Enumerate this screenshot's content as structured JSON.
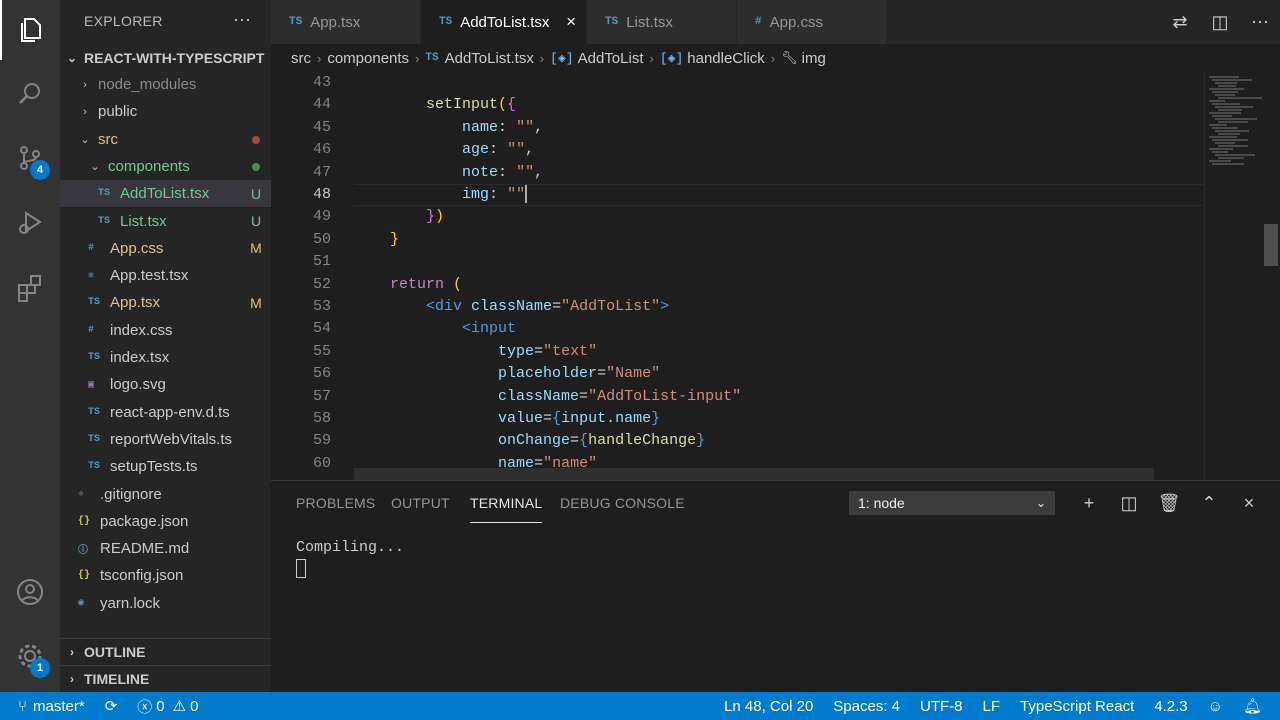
{
  "colors": {
    "accent": "#007acc",
    "modified": "#e2c08d",
    "untracked": "#73c991",
    "ts": "#519aba",
    "css": "#519aba"
  },
  "activity": {
    "scm_badge": "4",
    "settings_badge": "1"
  },
  "sidebar": {
    "title": "EXPLORER",
    "more": "···",
    "project": "REACT-WITH-TYPESCRIPT",
    "tree": [
      {
        "label": "node_modules",
        "kind": "folder",
        "open": false,
        "indent": 1,
        "color": "#8b8b8b",
        "mark": ""
      },
      {
        "label": "public",
        "kind": "folder",
        "open": false,
        "indent": 1,
        "color": "#cccccc",
        "mark": ""
      },
      {
        "label": "src",
        "kind": "folder",
        "open": true,
        "indent": 1,
        "color": "#e2c08d",
        "mark": "dot-red"
      },
      {
        "label": "components",
        "kind": "folder",
        "open": true,
        "indent": 2,
        "color": "#73c991",
        "mark": "dot-green"
      },
      {
        "label": "AddToList.tsx",
        "kind": "ts",
        "indent": 3,
        "color": "#73c991",
        "mark": "U",
        "selected": true
      },
      {
        "label": "List.tsx",
        "kind": "ts",
        "indent": 3,
        "color": "#73c991",
        "mark": "U"
      },
      {
        "label": "App.css",
        "kind": "css",
        "indent": 2,
        "color": "#e2c08d",
        "mark": "M"
      },
      {
        "label": "App.test.tsx",
        "kind": "react",
        "indent": 2,
        "color": "#cccccc",
        "mark": ""
      },
      {
        "label": "App.tsx",
        "kind": "ts",
        "indent": 2,
        "color": "#e2c08d",
        "mark": "M"
      },
      {
        "label": "index.css",
        "kind": "css",
        "indent": 2,
        "color": "#cccccc",
        "mark": ""
      },
      {
        "label": "index.tsx",
        "kind": "ts",
        "indent": 2,
        "color": "#cccccc",
        "mark": ""
      },
      {
        "label": "logo.svg",
        "kind": "svg",
        "indent": 2,
        "color": "#cccccc",
        "mark": ""
      },
      {
        "label": "react-app-env.d.ts",
        "kind": "ts",
        "indent": 2,
        "color": "#cccccc",
        "mark": ""
      },
      {
        "label": "reportWebVitals.ts",
        "kind": "ts",
        "indent": 2,
        "color": "#cccccc",
        "mark": ""
      },
      {
        "label": "setupTests.ts",
        "kind": "ts",
        "indent": 2,
        "color": "#cccccc",
        "mark": ""
      },
      {
        "label": ".gitignore",
        "kind": "git",
        "indent": 1,
        "color": "#cccccc",
        "mark": ""
      },
      {
        "label": "package.json",
        "kind": "json",
        "indent": 1,
        "color": "#cccccc",
        "mark": ""
      },
      {
        "label": "README.md",
        "kind": "info",
        "indent": 1,
        "color": "#cccccc",
        "mark": ""
      },
      {
        "label": "tsconfig.json",
        "kind": "json",
        "indent": 1,
        "color": "#cccccc",
        "mark": ""
      },
      {
        "label": "yarn.lock",
        "kind": "yarn",
        "indent": 1,
        "color": "#cccccc",
        "mark": ""
      }
    ],
    "outline": "OUTLINE",
    "timeline": "TIMELINE"
  },
  "tabs": [
    {
      "icon": "TS",
      "label": "App.tsx",
      "active": false
    },
    {
      "icon": "TS",
      "label": "AddToList.tsx",
      "active": true
    },
    {
      "icon": "TS",
      "label": "List.tsx",
      "active": false
    },
    {
      "icon": "#",
      "label": "App.css",
      "active": false
    }
  ],
  "breadcrumb": {
    "src": "src",
    "components": "components",
    "file_icon": "TS",
    "file": "AddToList.tsx",
    "component": "AddToList",
    "method": "handleClick",
    "prop": "img"
  },
  "editor": {
    "current_line": 48,
    "lines": [
      {
        "n": "43",
        "tokens": []
      },
      {
        "n": "44",
        "tokens": [
          [
            "plain",
            "        "
          ],
          [
            "fn",
            "setInput"
          ],
          [
            "br",
            "("
          ],
          [
            "br2",
            "{"
          ]
        ]
      },
      {
        "n": "45",
        "tokens": [
          [
            "plain",
            "            "
          ],
          [
            "prop",
            "name"
          ],
          [
            "plain",
            ": "
          ],
          [
            "str",
            "\"\""
          ],
          [
            "plain",
            ","
          ]
        ]
      },
      {
        "n": "46",
        "tokens": [
          [
            "plain",
            "            "
          ],
          [
            "prop",
            "age"
          ],
          [
            "plain",
            ": "
          ],
          [
            "str",
            "\"\""
          ],
          [
            "plain",
            ","
          ]
        ]
      },
      {
        "n": "47",
        "tokens": [
          [
            "plain",
            "            "
          ],
          [
            "prop",
            "note"
          ],
          [
            "plain",
            ": "
          ],
          [
            "str",
            "\"\""
          ],
          [
            "plain",
            ","
          ]
        ]
      },
      {
        "n": "48",
        "tokens": [
          [
            "plain",
            "            "
          ],
          [
            "prop",
            "img"
          ],
          [
            "plain",
            ": "
          ],
          [
            "str",
            "\"\""
          ]
        ],
        "caret": true
      },
      {
        "n": "49",
        "tokens": [
          [
            "plain",
            "        "
          ],
          [
            "br2",
            "}"
          ],
          [
            "br",
            ")"
          ]
        ]
      },
      {
        "n": "50",
        "tokens": [
          [
            "plain",
            "    "
          ],
          [
            "br",
            "}"
          ]
        ]
      },
      {
        "n": "51",
        "tokens": []
      },
      {
        "n": "52",
        "tokens": [
          [
            "plain",
            "    "
          ],
          [
            "kw",
            "return"
          ],
          [
            "plain",
            " "
          ],
          [
            "br",
            "("
          ]
        ]
      },
      {
        "n": "53",
        "tokens": [
          [
            "plain",
            "        "
          ],
          [
            "tag",
            "<div"
          ],
          [
            "plain",
            " "
          ],
          [
            "prop",
            "className"
          ],
          [
            "plain",
            "="
          ],
          [
            "str",
            "\"AddToList\""
          ],
          [
            "tag",
            ">"
          ]
        ]
      },
      {
        "n": "54",
        "tokens": [
          [
            "plain",
            "            "
          ],
          [
            "tag",
            "<input"
          ]
        ]
      },
      {
        "n": "55",
        "tokens": [
          [
            "plain",
            "                "
          ],
          [
            "prop",
            "type"
          ],
          [
            "plain",
            "="
          ],
          [
            "str",
            "\"text\""
          ]
        ]
      },
      {
        "n": "56",
        "tokens": [
          [
            "plain",
            "                "
          ],
          [
            "prop",
            "placeholder"
          ],
          [
            "plain",
            "="
          ],
          [
            "str",
            "\"Name\""
          ]
        ]
      },
      {
        "n": "57",
        "tokens": [
          [
            "plain",
            "                "
          ],
          [
            "prop",
            "className"
          ],
          [
            "plain",
            "="
          ],
          [
            "str",
            "\"AddToList-input\""
          ]
        ]
      },
      {
        "n": "58",
        "tokens": [
          [
            "plain",
            "                "
          ],
          [
            "prop",
            "value"
          ],
          [
            "plain",
            "="
          ],
          [
            "tag",
            "{"
          ],
          [
            "prop",
            "input"
          ],
          [
            "plain",
            "."
          ],
          [
            "prop",
            "name"
          ],
          [
            "tag",
            "}"
          ]
        ]
      },
      {
        "n": "59",
        "tokens": [
          [
            "plain",
            "                "
          ],
          [
            "prop",
            "onChange"
          ],
          [
            "plain",
            "="
          ],
          [
            "tag",
            "{"
          ],
          [
            "fn",
            "handleChange"
          ],
          [
            "tag",
            "}"
          ]
        ]
      },
      {
        "n": "60",
        "tokens": [
          [
            "plain",
            "                "
          ],
          [
            "prop",
            "name"
          ],
          [
            "plain",
            "="
          ],
          [
            "str",
            "\"name\""
          ]
        ]
      }
    ]
  },
  "panel": {
    "tabs": [
      "PROBLEMS",
      "OUTPUT",
      "TERMINAL",
      "DEBUG CONSOLE"
    ],
    "active_tab": "TERMINAL",
    "terminal_select": "1: node",
    "output": "Compiling..."
  },
  "status": {
    "branch": "master*",
    "errors": "0",
    "warnings": "0",
    "position": "Ln 48, Col 20",
    "spaces": "Spaces: 4",
    "encoding": "UTF-8",
    "eol": "LF",
    "language": "TypeScript React",
    "version": "4.2.3"
  }
}
